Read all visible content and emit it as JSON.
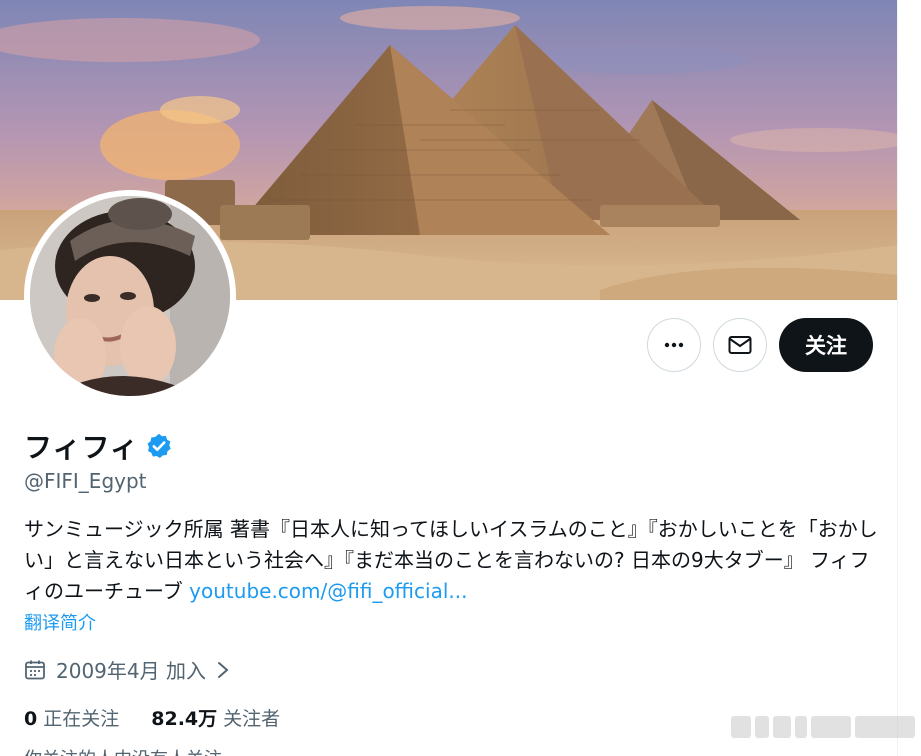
{
  "profile": {
    "display_name": "フィフィ",
    "handle": "@FIFI_Egypt",
    "verified_icon": "verified-badge-icon",
    "bio_text": "サンミュージック所属 著書『日本人に知ってほしいイスラムのこと』『おかしいことを「おかしい」と言えない日本という社会へ』『まだ本当のことを言わないの? 日本の9大タブー』 フィフィのユーチューブ ",
    "bio_link": "youtube.com/@fifi_official...",
    "translate_label": "翻译简介",
    "joined_text": "2009年4月 加入",
    "following_count": "0",
    "following_label": "正在关注",
    "followers_count": "82.4万",
    "followers_label": "关注者",
    "cut_text": "你关注的人中没有人关注"
  },
  "actions": {
    "more_icon": "more-dots-icon",
    "message_icon": "envelope-icon",
    "follow_label": "关注"
  },
  "colors": {
    "accent": "#1d9bf0",
    "text": "#0f1419",
    "secondary": "#536471",
    "follow_bg": "#0f1419"
  }
}
